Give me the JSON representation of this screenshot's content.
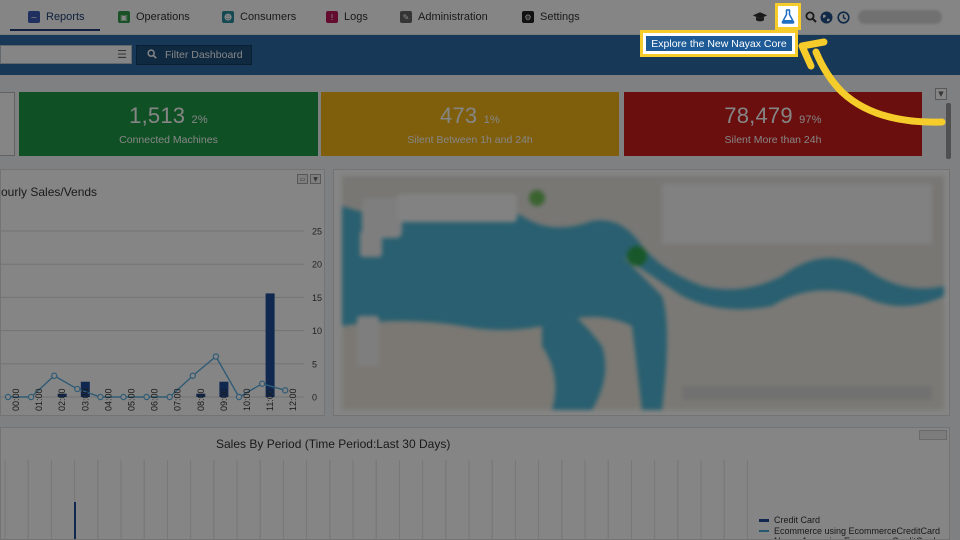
{
  "nav": {
    "tabs": [
      {
        "label": "Reports",
        "icon": "reports-icon",
        "color": "#3b5ab8"
      },
      {
        "label": "Operations",
        "icon": "operations-icon",
        "color": "#2e9e4a"
      },
      {
        "label": "Consumers",
        "icon": "consumers-icon",
        "color": "#2a8fa0"
      },
      {
        "label": "Logs",
        "icon": "logs-icon",
        "color": "#c0185a"
      },
      {
        "label": "Administration",
        "icon": "administration-icon",
        "color": "#666666"
      },
      {
        "label": "Settings",
        "icon": "settings-icon",
        "color": "#222222"
      }
    ],
    "right_icons": [
      "graduation-cap-icon",
      "flask-icon",
      "search-icon",
      "globe-icon",
      "history-icon"
    ]
  },
  "filter": {
    "button_label": "Filter Dashboard"
  },
  "callout": {
    "label": "Explore the New Nayax Core",
    "highlight_color": "#f5cc2a"
  },
  "kpis": [
    {
      "value": "1,513",
      "pct": "2%",
      "label": "Connected Machines",
      "color": "#1d9a47"
    },
    {
      "value": "473",
      "pct": "1%",
      "label": "Silent Between 1h and 24h",
      "color": "#f3b618"
    },
    {
      "value": "78,479",
      "pct": "97%",
      "label": "Silent More than 24h",
      "color": "#cc1b1b"
    }
  ],
  "hourly": {
    "title": "ourly Sales/Vends"
  },
  "period": {
    "title": "Sales By Period (Time Period:Last 30 Days)",
    "legend": [
      {
        "label": "Credit Card",
        "color": "#1f4e9a"
      },
      {
        "label": "Ecommerce using EcommerceCreditCard",
        "color": "#4aa8d8"
      },
      {
        "label": "Nayax App using EcommerceCreditCard",
        "color": "#2e9e4a"
      }
    ]
  },
  "chart_data": {
    "type": "bar",
    "title": "",
    "categories": [
      "00:00",
      "01:00",
      "02:00",
      "03:00",
      "04:00",
      "05:00",
      "06:00",
      "07:00",
      "08:00",
      "09:00",
      "10:00",
      "11:00",
      "12:00"
    ],
    "ylim": [
      0,
      25
    ],
    "yticks": [
      0,
      5,
      10,
      15,
      20,
      25
    ],
    "series": [
      {
        "kind": "bar",
        "values": [
          0,
          0,
          0.5,
          2.3,
          0,
          0,
          0,
          0,
          0.5,
          2.3,
          0,
          15.6,
          0
        ]
      },
      {
        "kind": "line",
        "values": [
          0,
          0,
          3.2,
          1.2,
          0,
          0,
          0,
          0,
          3.2,
          6.1,
          0,
          2,
          1
        ]
      }
    ],
    "grid": true
  }
}
